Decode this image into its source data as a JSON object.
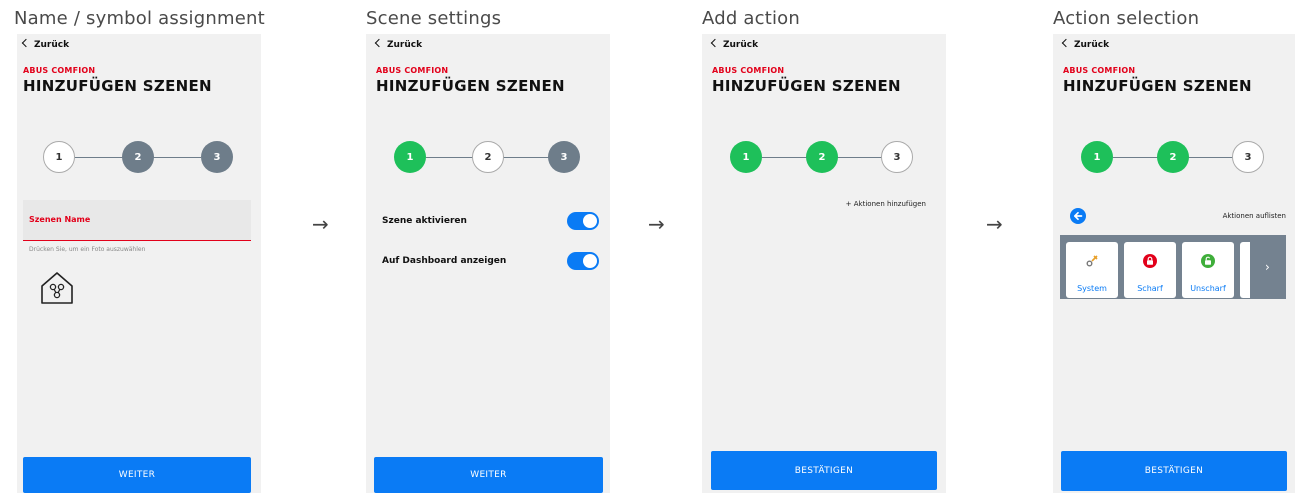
{
  "captions": [
    "Name / symbol assignment",
    "Scene settings",
    "Add action",
    "Action selection"
  ],
  "back_label": "Zurück",
  "brand": "ABUS COMFION",
  "page_title": "HINZUFÜGEN SZENEN",
  "steps": [
    "1",
    "2",
    "3"
  ],
  "screen1": {
    "field_label": "Szenen Name",
    "photo_hint": "Drücken Sie, um ein Foto auszuwählen",
    "button": "WEITER"
  },
  "screen2": {
    "toggle1_label": "Szene aktivieren",
    "toggle2_label": "Auf Dashboard anzeigen",
    "toggle1_on": true,
    "toggle2_on": true,
    "button": "WEITER"
  },
  "screen3": {
    "add_actions": "+ Aktionen hinzufügen",
    "button": "BESTÄTIGEN"
  },
  "screen4": {
    "list_actions": "Aktionen auflisten",
    "tiles": [
      "System",
      "Scharf",
      "Unscharf"
    ],
    "button": "BESTÄTIGEN"
  },
  "colors": {
    "accent": "#0a7bf5",
    "brand_red": "#e2001a",
    "step_green": "#1ec05a",
    "step_gray": "#6e7d8a"
  }
}
